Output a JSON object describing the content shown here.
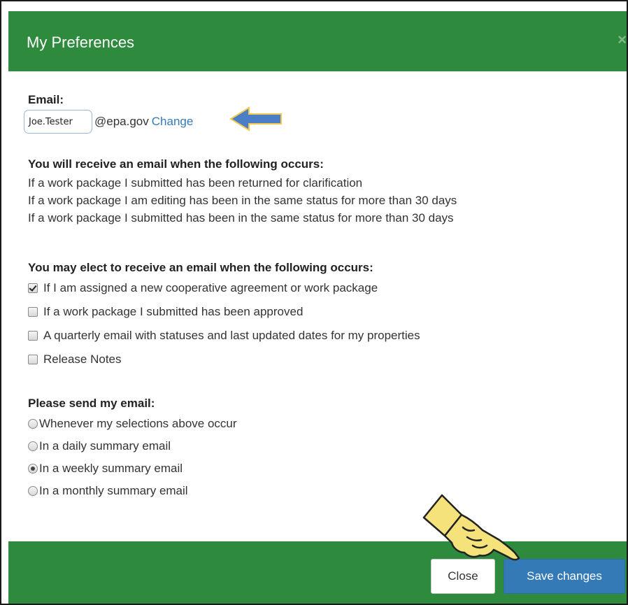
{
  "dialog": {
    "title": "My Preferences",
    "close_glyph": "×"
  },
  "email": {
    "label": "Email:",
    "username_value": "Joe.Tester",
    "domain": "@epa.gov",
    "change_link": "Change"
  },
  "automatic": {
    "heading": "You will receive an email when the following occurs:",
    "items": [
      "If a work package I submitted has been returned for clarification",
      "If a work package I am editing has been in the same status for more than 30 days",
      "If a work package I submitted has been in the same status for more than 30 days"
    ]
  },
  "optional": {
    "heading": "You may elect to receive an email when the following occurs:",
    "options": [
      {
        "label": "If I am assigned a new cooperative agreement or work package",
        "checked": true
      },
      {
        "label": "If a work package I submitted has been approved",
        "checked": false
      },
      {
        "label": "A quarterly email with statuses and last updated dates for my properties",
        "checked": false
      },
      {
        "label": "Release Notes",
        "checked": false
      }
    ]
  },
  "frequency": {
    "heading": "Please send my email:",
    "options": [
      {
        "label": "Whenever my selections above occur",
        "selected": false
      },
      {
        "label": "In a daily summary email",
        "selected": false
      },
      {
        "label": "In a weekly summary email",
        "selected": true
      },
      {
        "label": "In a monthly summary email",
        "selected": false
      }
    ]
  },
  "footer": {
    "close_label": "Close",
    "save_label": "Save changes"
  },
  "colors": {
    "header_green": "#2e8b3e",
    "primary_blue": "#337ab7",
    "annotation_arrow": "#4a7fc8"
  },
  "annotations": {
    "arrow_icon": "left-arrow-icon",
    "pointer_icon": "pointing-hand-icon"
  }
}
